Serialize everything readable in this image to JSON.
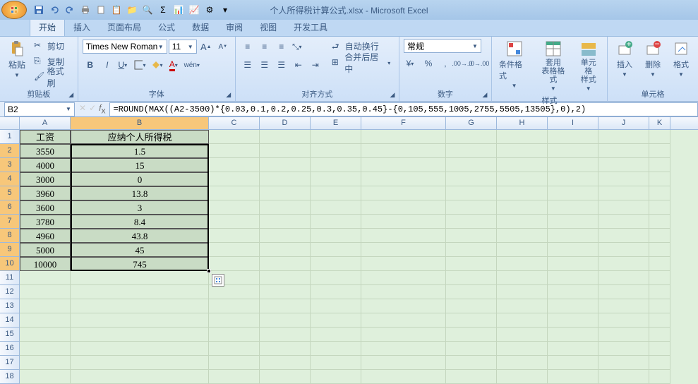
{
  "title": "个人所得税计算公式.xlsx - Microsoft Excel",
  "tabs": [
    "开始",
    "插入",
    "页面布局",
    "公式",
    "数据",
    "审阅",
    "视图",
    "开发工具"
  ],
  "active_tab": 0,
  "ribbon": {
    "clipboard": {
      "label": "剪贴板",
      "paste": "粘贴",
      "cut": "剪切",
      "copy": "复制",
      "format_painter": "格式刷"
    },
    "font": {
      "label": "字体",
      "name": "Times New Roman",
      "size": "11",
      "bold": "B",
      "italic": "I",
      "underline": "U"
    },
    "align": {
      "label": "对齐方式",
      "wrap": "自动换行",
      "merge": "合并后居中"
    },
    "number": {
      "label": "数字",
      "format": "常规"
    },
    "styles": {
      "label": "样式",
      "cond": "条件格式",
      "table": "套用\n表格格式",
      "cell": "单元格\n样式"
    },
    "cells": {
      "label": "单元格",
      "insert": "插入",
      "delete": "删除",
      "format": "格式"
    }
  },
  "name_box": "B2",
  "formula": "=ROUND(MAX((A2-3500)*{0.03,0.1,0.2,0.25,0.3,0.35,0.45}-{0,105,555,1005,2755,5505,13505},0),2)",
  "columns": [
    "A",
    "B",
    "C",
    "D",
    "E",
    "F",
    "G",
    "H",
    "I",
    "J",
    "K"
  ],
  "headers": {
    "A": "工资",
    "B": "应纳个人所得税"
  },
  "rows_data": [
    {
      "a": "3550",
      "b": "1.5"
    },
    {
      "a": "4000",
      "b": "15"
    },
    {
      "a": "3000",
      "b": "0"
    },
    {
      "a": "3960",
      "b": "13.8"
    },
    {
      "a": "3600",
      "b": "3"
    },
    {
      "a": "3780",
      "b": "8.4"
    },
    {
      "a": "4960",
      "b": "43.8"
    },
    {
      "a": "5000",
      "b": "45"
    },
    {
      "a": "10000",
      "b": "745"
    }
  ],
  "visible_rows": 18
}
